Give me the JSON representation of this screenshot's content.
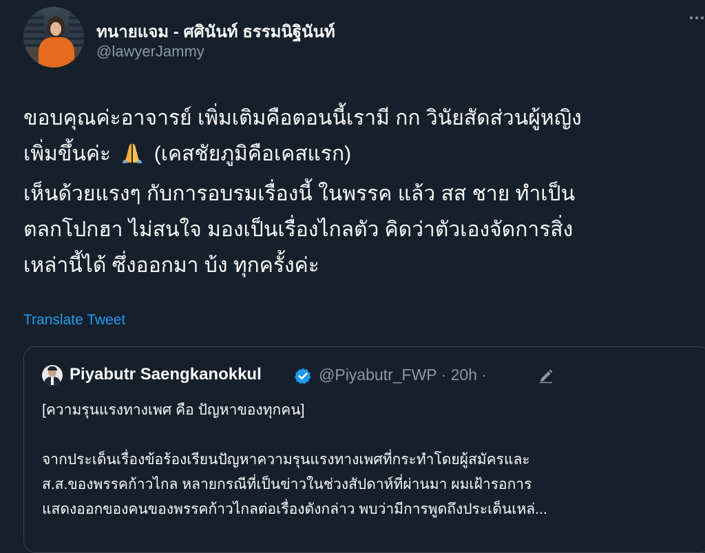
{
  "author": {
    "display_name": "ทนายแจม - ศศินันท์ ธรรมนิฐินันท์",
    "handle": "@lawyerJammy"
  },
  "tweet": {
    "paragraph1_line1": "ขอบคุณค่ะอาจารย์ เพิ่มเติมคือตอนนี้เรามี กก วินัยสัดส่วนผู้หญิง",
    "paragraph1_line2_before": "เพิ่มขึ้นค่ะ",
    "emoji": "folded-hands",
    "paragraph1_line2_after": "(เคสชัยภูมิคือเคสแรก)",
    "paragraph2_line1": "เห็นด้วยแรงๆ กับการอบรมเรื่องนี้ ในพรรค แล้ว สส ชาย ทำเป็น",
    "paragraph2_line2": "ตลกโปกฮา ไม่สนใจ มองเป็นเรื่องไกลตัว คิดว่าตัวเองจัดการสิ่ง",
    "paragraph2_line3": "เหล่านี้ได้ ซึ่งออกมา บ้ง ทุกครั้งค่ะ"
  },
  "translate_label": "Translate Tweet",
  "quoted": {
    "name": "Piyabutr Saengkanokkul",
    "meta": "@Piyabutr_FWP · 20h ·",
    "line1": "[ความรุนแรงทางเพศ คือ ปัญหาของทุกคน]",
    "line2": "จากประเด็นเรื่องข้อร้องเรียนปัญหาความรุนแรงทางเพศที่กระทำโดยผู้สมัครและ",
    "line3": "ส.ส.ของพรรคก้าวไกล หลายกรณีที่เป็นข่าวในช่วงสัปดาห์ที่ผ่านมา ผมเฝ้ารอการ",
    "line4": "แสดงออกของคนของพรรคก้าวไกลต่อเรื่องดังกล่าว พบว่ามีการพูดถึงประเด็นเหล่..."
  },
  "colors": {
    "background": "#15202b",
    "text": "#f7f9f9",
    "secondary": "#8b98a5",
    "link": "#1d9bf0",
    "border": "#38444d"
  }
}
